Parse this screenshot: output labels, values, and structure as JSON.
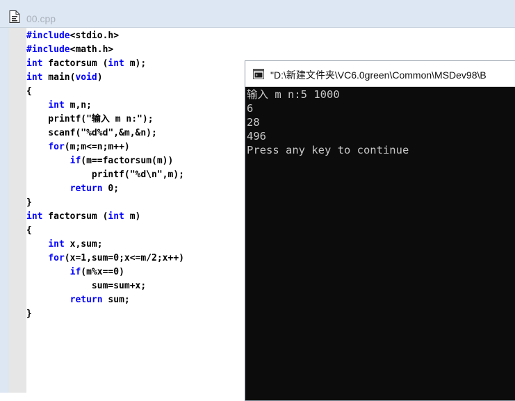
{
  "editor": {
    "title": "00.cpp",
    "code_lines": [
      [
        {
          "t": "#include",
          "c": "kw"
        },
        {
          "t": "<stdio.h>",
          "c": ""
        }
      ],
      [
        {
          "t": "#include",
          "c": "kw"
        },
        {
          "t": "<math.h>",
          "c": ""
        }
      ],
      [
        {
          "t": "int",
          "c": "kw"
        },
        {
          "t": " factorsum (",
          "c": ""
        },
        {
          "t": "int",
          "c": "kw"
        },
        {
          "t": " m);",
          "c": ""
        }
      ],
      [
        {
          "t": "int",
          "c": "kw"
        },
        {
          "t": " main(",
          "c": ""
        },
        {
          "t": "void",
          "c": "kw"
        },
        {
          "t": ")",
          "c": ""
        }
      ],
      [
        {
          "t": "{",
          "c": ""
        }
      ],
      [
        {
          "t": "    ",
          "c": ""
        },
        {
          "t": "int",
          "c": "kw"
        },
        {
          "t": " m,n;",
          "c": ""
        }
      ],
      [
        {
          "t": "    printf(\"输入 m n:\");",
          "c": ""
        }
      ],
      [
        {
          "t": "    scanf(\"%d%d\",&m,&n);",
          "c": ""
        }
      ],
      [
        {
          "t": "    ",
          "c": ""
        },
        {
          "t": "for",
          "c": "kw"
        },
        {
          "t": "(m;m<=n;m++)",
          "c": ""
        }
      ],
      [
        {
          "t": "        ",
          "c": ""
        },
        {
          "t": "if",
          "c": "kw"
        },
        {
          "t": "(m==factorsum(m))",
          "c": ""
        }
      ],
      [
        {
          "t": "            printf(\"%d\\n\",m);",
          "c": ""
        }
      ],
      [
        {
          "t": "        ",
          "c": ""
        },
        {
          "t": "return",
          "c": "kw"
        },
        {
          "t": " 0;",
          "c": ""
        }
      ],
      [
        {
          "t": "}",
          "c": ""
        }
      ],
      [
        {
          "t": "int",
          "c": "kw"
        },
        {
          "t": " factorsum (",
          "c": ""
        },
        {
          "t": "int",
          "c": "kw"
        },
        {
          "t": " m)",
          "c": ""
        }
      ],
      [
        {
          "t": "{",
          "c": ""
        }
      ],
      [
        {
          "t": "    ",
          "c": ""
        },
        {
          "t": "int",
          "c": "kw"
        },
        {
          "t": " x,sum;",
          "c": ""
        }
      ],
      [
        {
          "t": "    ",
          "c": ""
        },
        {
          "t": "for",
          "c": "kw"
        },
        {
          "t": "(x=1,sum=0;x<=m/2;x++)",
          "c": ""
        }
      ],
      [
        {
          "t": "        ",
          "c": ""
        },
        {
          "t": "if",
          "c": "kw"
        },
        {
          "t": "(m%x==0)",
          "c": ""
        }
      ],
      [
        {
          "t": "            sum=sum+x;",
          "c": ""
        }
      ],
      [
        {
          "t": "        ",
          "c": ""
        },
        {
          "t": "return",
          "c": "kw"
        },
        {
          "t": " sum;",
          "c": ""
        }
      ],
      [
        {
          "t": "}",
          "c": ""
        }
      ]
    ]
  },
  "console": {
    "title": "\"D:\\新建文件夹\\VC6.0green\\Common\\MSDev98\\B",
    "output_lines": [
      "输入 m n:5 1000",
      "6",
      "28",
      "496",
      "Press any key to continue"
    ]
  },
  "icons": {
    "editor_icon": "cpp-source-file-icon",
    "console_icon": "console-window-icon"
  },
  "colors": {
    "keyword": "#0000ff",
    "console_bg": "#0c0c0c",
    "console_text": "#c7c7c7"
  }
}
